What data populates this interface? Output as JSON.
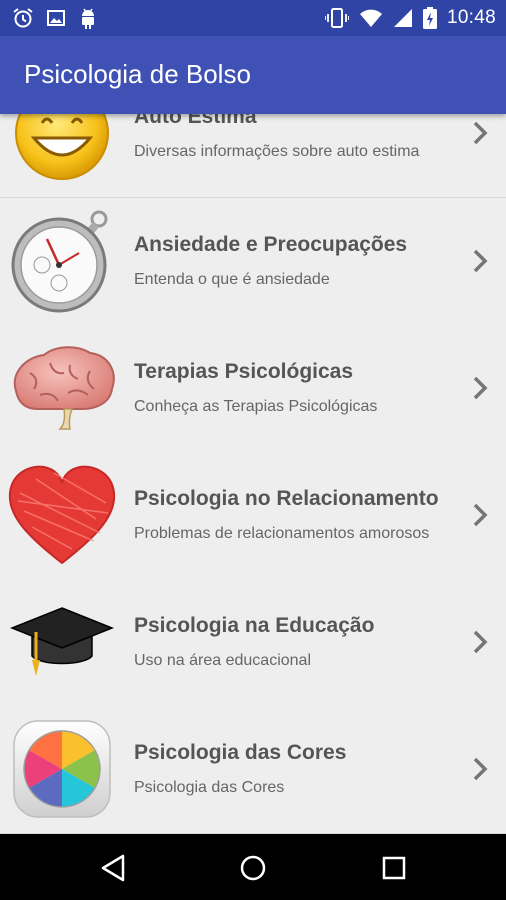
{
  "status_bar": {
    "time": "10:48",
    "left_icons": [
      "alarm-icon",
      "image-icon",
      "android-icon"
    ],
    "right_icons": [
      "vibrate-icon",
      "wifi-icon",
      "signal-icon",
      "battery-charging-icon"
    ]
  },
  "app_bar": {
    "title": "Psicologia de Bolso",
    "color": "#3f51b5"
  },
  "list": {
    "items": [
      {
        "title": "Auto Estima",
        "subtitle": "Diversas informações sobre auto estima",
        "icon": "smiley-face-icon"
      },
      {
        "title": "Ansiedade e Preocupações",
        "subtitle": "Entenda o que é ansiedade",
        "icon": "stopwatch-icon"
      },
      {
        "title": "Terapias Psicológicas",
        "subtitle": "Conheça as Terapias Psicológicas",
        "icon": "brain-icon"
      },
      {
        "title": "Psicologia no Relacionamento",
        "subtitle": "Problemas de relacionamentos amorosos",
        "icon": "heart-icon"
      },
      {
        "title": "Psicologia na Educação",
        "subtitle": "Uso na área educacional",
        "icon": "graduation-cap-icon"
      },
      {
        "title": "Psicologia das Cores",
        "subtitle": "Psicologia das Cores",
        "icon": "color-wheel-icon"
      }
    ]
  },
  "nav_bar": {
    "buttons": [
      "back-icon",
      "home-icon",
      "recents-icon"
    ]
  }
}
